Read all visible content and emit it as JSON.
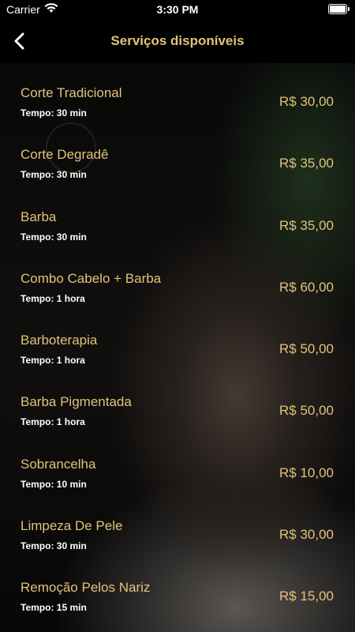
{
  "status_bar": {
    "carrier": "Carrier",
    "time": "3:30 PM"
  },
  "nav": {
    "title": "Serviços disponíveis",
    "back_icon": "chevron-left-icon"
  },
  "colors": {
    "accent": "#e2c27a",
    "background": "#000000",
    "text": "#ffffff"
  },
  "services": [
    {
      "name": "Corte Tradicional",
      "duration": "Tempo: 30 min",
      "price": "R$ 30,00"
    },
    {
      "name": "Corte Degradê",
      "duration": "Tempo: 30 min",
      "price": "R$ 35,00"
    },
    {
      "name": "Barba",
      "duration": "Tempo: 30 min",
      "price": "R$ 35,00"
    },
    {
      "name": "Combo Cabelo + Barba",
      "duration": "Tempo: 1 hora",
      "price": "R$ 60,00"
    },
    {
      "name": "Barboterapia",
      "duration": "Tempo: 1 hora",
      "price": "R$ 50,00"
    },
    {
      "name": "Barba Pigmentada",
      "duration": "Tempo: 1 hora",
      "price": "R$ 50,00"
    },
    {
      "name": "Sobrancelha",
      "duration": "Tempo: 10 min",
      "price": "R$ 10,00"
    },
    {
      "name": "Limpeza De Pele",
      "duration": "Tempo: 30 min",
      "price": "R$ 30,00"
    },
    {
      "name": "Remoção Pelos Nariz",
      "duration": "Tempo: 15 min",
      "price": "R$ 15,00"
    }
  ]
}
